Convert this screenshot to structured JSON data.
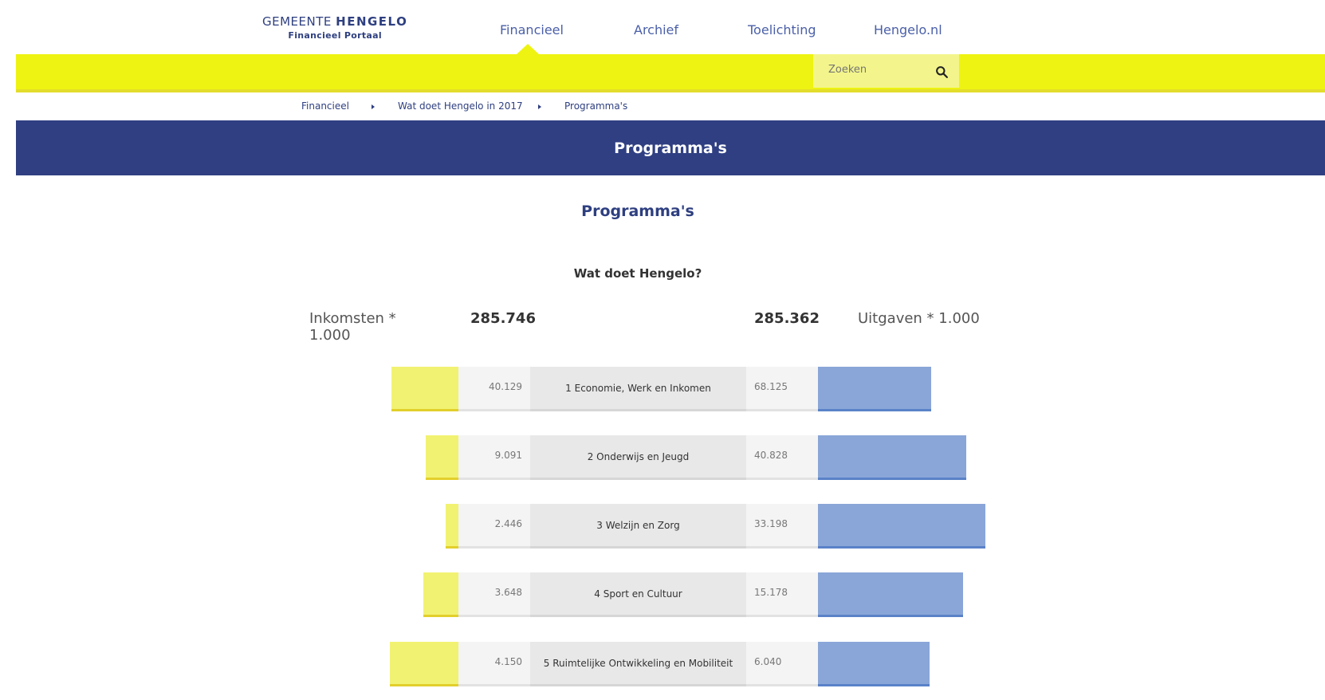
{
  "header": {
    "logo_line1_a": "GEMEENTE",
    "logo_line1_b": "HENGELO",
    "logo_line2": "Financieel Portaal",
    "nav": [
      "Financieel",
      "Archief",
      "Toelichting",
      "Hengelo.nl"
    ],
    "active_nav": "Financieel"
  },
  "search": {
    "placeholder": "Zoeken"
  },
  "breadcrumb": [
    "Financieel",
    "Wat doet Hengelo in 2017",
    "Programma's"
  ],
  "banner": {
    "title": "Programma's"
  },
  "main": {
    "subtitle": "Programma's",
    "question": "Wat doet Hengelo?",
    "income_label": "Inkomsten * 1.000",
    "income_total": "285.746",
    "expense_total": "285.362",
    "expense_label": "Uitgaven * 1.000"
  },
  "colors": {
    "yellow": "#eef311",
    "navy": "#2f3f82",
    "expense_bar": "#8aa6d8",
    "income_bar": "#f2f272"
  },
  "programs": [
    {
      "name": "1 Economie, Werk en Inkomen",
      "income": "40.129",
      "expense": "68.125"
    },
    {
      "name": "2 Onderwijs en Jeugd",
      "income": "9.091",
      "expense": "40.828"
    },
    {
      "name": "3 Welzijn en Zorg",
      "income": "2.446",
      "expense": "33.198"
    },
    {
      "name": "4 Sport en Cultuur",
      "income": "3.648",
      "expense": "15.178"
    },
    {
      "name": "5 Ruimtelijke Ontwikkeling en Mobiliteit",
      "income": "4.150",
      "expense": "6.040"
    }
  ]
}
